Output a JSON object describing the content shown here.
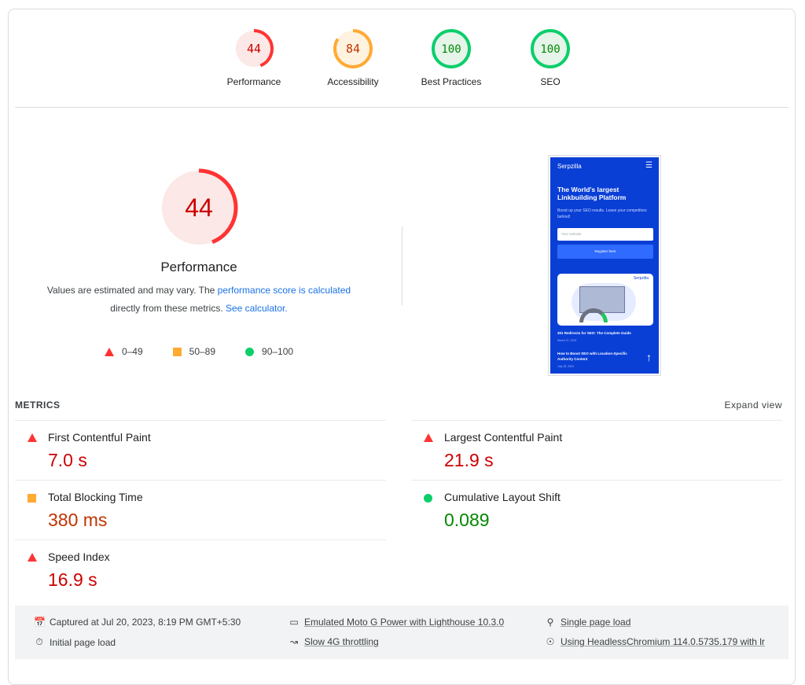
{
  "top_gauges": [
    {
      "score": "44",
      "value": 0.44,
      "label": "Performance",
      "color": "#ff3333",
      "bg": "#fce8e6",
      "text": "#cc0000"
    },
    {
      "score": "84",
      "value": 0.84,
      "label": "Accessibility",
      "color": "#ffaa33",
      "bg": "#fff3e0",
      "text": "#c33300"
    },
    {
      "score": "100",
      "value": 1.0,
      "label": "Best Practices",
      "color": "#0cce6b",
      "bg": "#e6f4ea",
      "text": "#008800"
    },
    {
      "score": "100",
      "value": 1.0,
      "label": "SEO",
      "color": "#0cce6b",
      "bg": "#e6f4ea",
      "text": "#008800"
    }
  ],
  "performance": {
    "score": "44",
    "value": 0.44,
    "title": "Performance",
    "desc_pre": "Values are estimated and may vary. The ",
    "desc_link": "performance score is calculated",
    "desc_mid": "directly from these metrics. ",
    "desc_link2": "See calculator."
  },
  "legend": {
    "fail": "0–49",
    "average": "50–89",
    "pass": "90–100"
  },
  "screenshot": {
    "brand": "Serpzilla",
    "headline": "The World's largest Linkbuilding Platform",
    "sub": "Boost up your SEO results. Leave your competitors behind!",
    "input_placeholder": "Your website",
    "register": "Register here",
    "post1": "301 Redirects for SEO: The Complete Guide",
    "date1": "March 27, 2023",
    "post2": "How to Boost SEO with Location-Specific Authority Content",
    "date2": "July 18, 2023"
  },
  "metrics": {
    "label": "METRICS",
    "expand": "Expand view",
    "items": [
      {
        "name": "First Contentful Paint",
        "value": "7.0 s",
        "rating": "bad"
      },
      {
        "name": "Largest Contentful Paint",
        "value": "21.9 s",
        "rating": "bad"
      },
      {
        "name": "Total Blocking Time",
        "value": "380 ms",
        "rating": "avg"
      },
      {
        "name": "Cumulative Layout Shift",
        "value": "0.089",
        "rating": "good"
      },
      {
        "name": "Speed Index",
        "value": "16.9 s",
        "rating": "bad"
      }
    ]
  },
  "footer": {
    "captured": "Captured at Jul 20, 2023, 8:19 PM GMT+5:30",
    "initial": "Initial page load",
    "emulated": "Emulated Moto G Power with Lighthouse 10.3.0",
    "throttling": "Slow 4G throttling",
    "single": "Single page load",
    "browser": "Using HeadlessChromium 114.0.5735.179 with lr"
  }
}
